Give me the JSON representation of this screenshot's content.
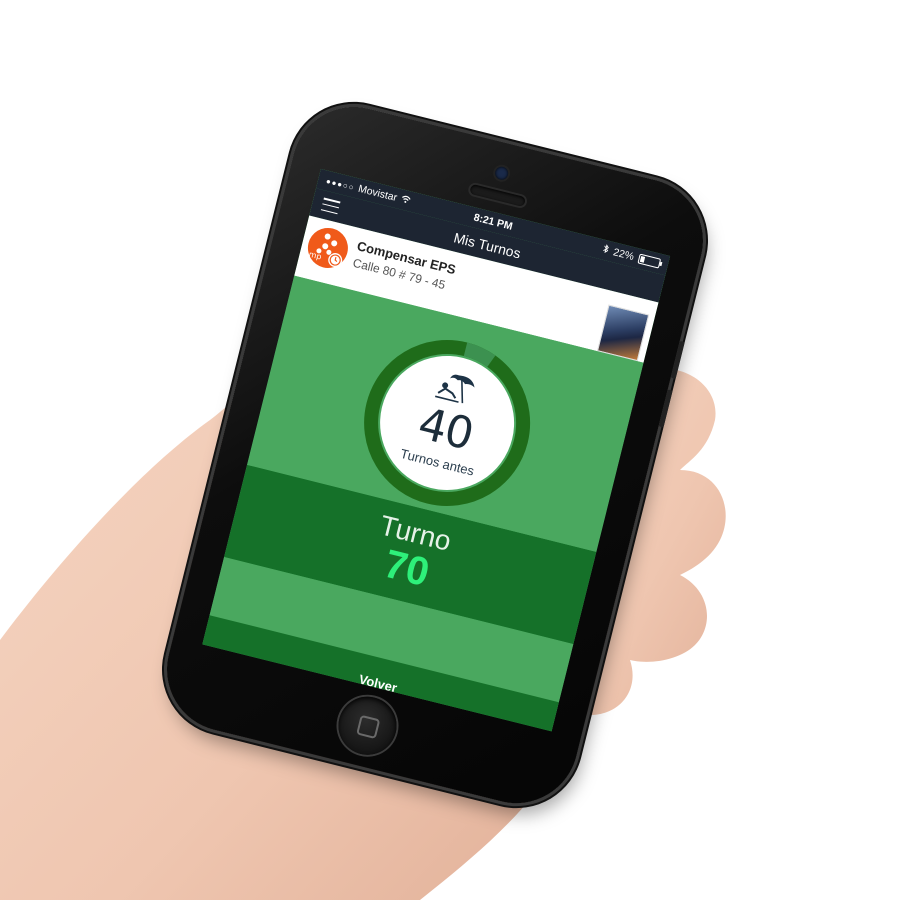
{
  "status_bar": {
    "signal": "●●●○○",
    "carrier": "Movistar",
    "time": "8:21 PM",
    "battery_percent": "22%",
    "battery_level": 0.22
  },
  "nav": {
    "title": "Mis Turnos",
    "menu_icon": "hamburger-icon"
  },
  "location": {
    "logo_icon": "mp-logo",
    "name": "Compensar EPS",
    "address": "Calle 80 # 79 - 45",
    "thumbnail": "building-photo"
  },
  "queue": {
    "turns_before": "40",
    "turns_before_label": "Turnos antes",
    "progress_fraction": 0.06,
    "icon": "beach-umbrella-icon"
  },
  "ticket": {
    "label": "Turno",
    "number": "70"
  },
  "footer": {
    "back_label": "Volver"
  },
  "colors": {
    "screen_green": "#4aa85f",
    "dark_green": "#157129",
    "accent_green": "#2ef07a",
    "nav_dark": "#1d2532",
    "brand_orange": "#f05a1a"
  }
}
